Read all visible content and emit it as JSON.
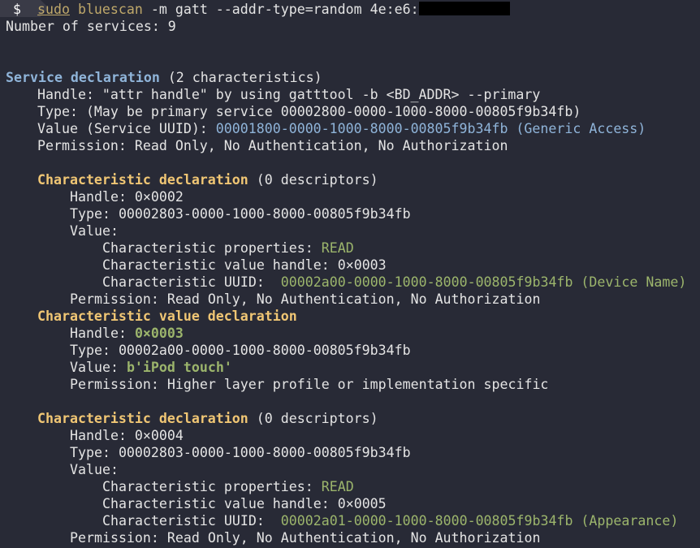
{
  "prompt": {
    "symbol": "$",
    "sudo": "sudo",
    "command": "bluescan",
    "args": " -m gatt --addr-type=random 4e:e6:"
  },
  "summary": "Number of services: 9",
  "service": {
    "heading": "Service declaration",
    "count": " (2 characteristics)",
    "handle": "Handle: \"attr handle\" by using gatttool -b <BD_ADDR> --primary",
    "type": "Type: (May be primary service 00002800-0000-1000-8000-00805f9b34fb)",
    "value_label": "Value (Service UUID): ",
    "value_uuid": "00001800-0000-1000-8000-00805f9b34fb (Generic Access)",
    "permission": "Permission: Read Only, No Authentication, No Authorization"
  },
  "char1": {
    "heading": "Characteristic declaration",
    "count": " (0 descriptors)",
    "handle": "Handle: 0×0002",
    "type": "Type: 00002803-0000-1000-8000-00805f9b34fb",
    "value": "Value:",
    "props_label": "Characteristic properties: ",
    "props": "READ",
    "value_handle": "Characteristic value handle: 0×0003",
    "uuid_label": "Characteristic UUID:  ",
    "uuid": "00002a00-0000-1000-8000-00805f9b34fb (Device Name)",
    "permission": "Permission: Read Only, No Authentication, No Authorization"
  },
  "value_decl": {
    "heading": "Characteristic value declaration",
    "handle_label": "Handle: ",
    "handle": "0×0003",
    "type": "Type: 00002a00-0000-1000-8000-00805f9b34fb",
    "value_label": "Value: ",
    "value": "b'iPod touch'",
    "permission": "Permission: Higher layer profile or implementation specific"
  },
  "char2": {
    "heading": "Characteristic declaration",
    "count": " (0 descriptors)",
    "handle": "Handle: 0×0004",
    "type": "Type: 00002803-0000-1000-8000-00805f9b34fb",
    "value": "Value:",
    "props_label": "Characteristic properties: ",
    "props": "READ",
    "value_handle": "Characteristic value handle: 0×0005",
    "uuid_label": "Characteristic UUID:  ",
    "uuid": "00002a01-0000-1000-8000-00805f9b34fb (Appearance)",
    "permission": "Permission: Read Only, No Authentication, No Authorization"
  }
}
